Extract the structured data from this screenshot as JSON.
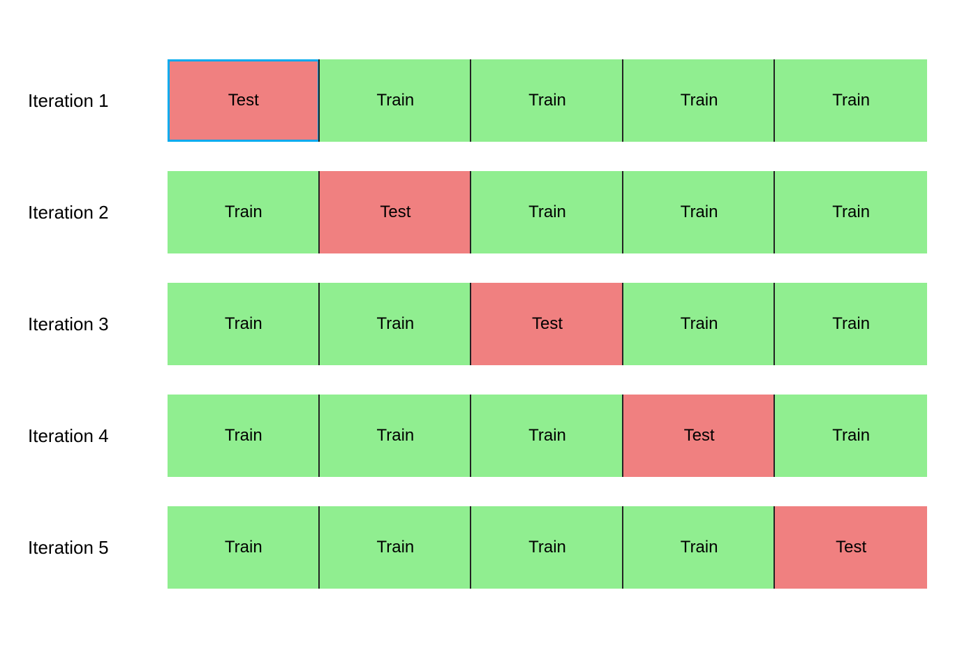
{
  "iterations": [
    {
      "label": "Iteration 1",
      "blocks": [
        {
          "type": "test",
          "text": "Test",
          "outlined": true
        },
        {
          "type": "train",
          "text": "Train",
          "outlined": false
        },
        {
          "type": "train",
          "text": "Train",
          "outlined": false
        },
        {
          "type": "train",
          "text": "Train",
          "outlined": false
        },
        {
          "type": "train",
          "text": "Train",
          "outlined": false
        }
      ]
    },
    {
      "label": "Iteration 2",
      "blocks": [
        {
          "type": "train",
          "text": "Train",
          "outlined": false
        },
        {
          "type": "test",
          "text": "Test",
          "outlined": false
        },
        {
          "type": "train",
          "text": "Train",
          "outlined": false
        },
        {
          "type": "train",
          "text": "Train",
          "outlined": false
        },
        {
          "type": "train",
          "text": "Train",
          "outlined": false
        }
      ]
    },
    {
      "label": "Iteration 3",
      "blocks": [
        {
          "type": "train",
          "text": "Train",
          "outlined": false
        },
        {
          "type": "train",
          "text": "Train",
          "outlined": false
        },
        {
          "type": "test",
          "text": "Test",
          "outlined": false
        },
        {
          "type": "train",
          "text": "Train",
          "outlined": false
        },
        {
          "type": "train",
          "text": "Train",
          "outlined": false
        }
      ]
    },
    {
      "label": "Iteration 4",
      "blocks": [
        {
          "type": "train",
          "text": "Train",
          "outlined": false
        },
        {
          "type": "train",
          "text": "Train",
          "outlined": false
        },
        {
          "type": "train",
          "text": "Train",
          "outlined": false
        },
        {
          "type": "test",
          "text": "Test",
          "outlined": false
        },
        {
          "type": "train",
          "text": "Train",
          "outlined": false
        }
      ]
    },
    {
      "label": "Iteration 5",
      "blocks": [
        {
          "type": "train",
          "text": "Train",
          "outlined": false
        },
        {
          "type": "train",
          "text": "Train",
          "outlined": false
        },
        {
          "type": "train",
          "text": "Train",
          "outlined": false
        },
        {
          "type": "train",
          "text": "Train",
          "outlined": false
        },
        {
          "type": "test",
          "text": "Test",
          "outlined": false
        }
      ]
    }
  ]
}
